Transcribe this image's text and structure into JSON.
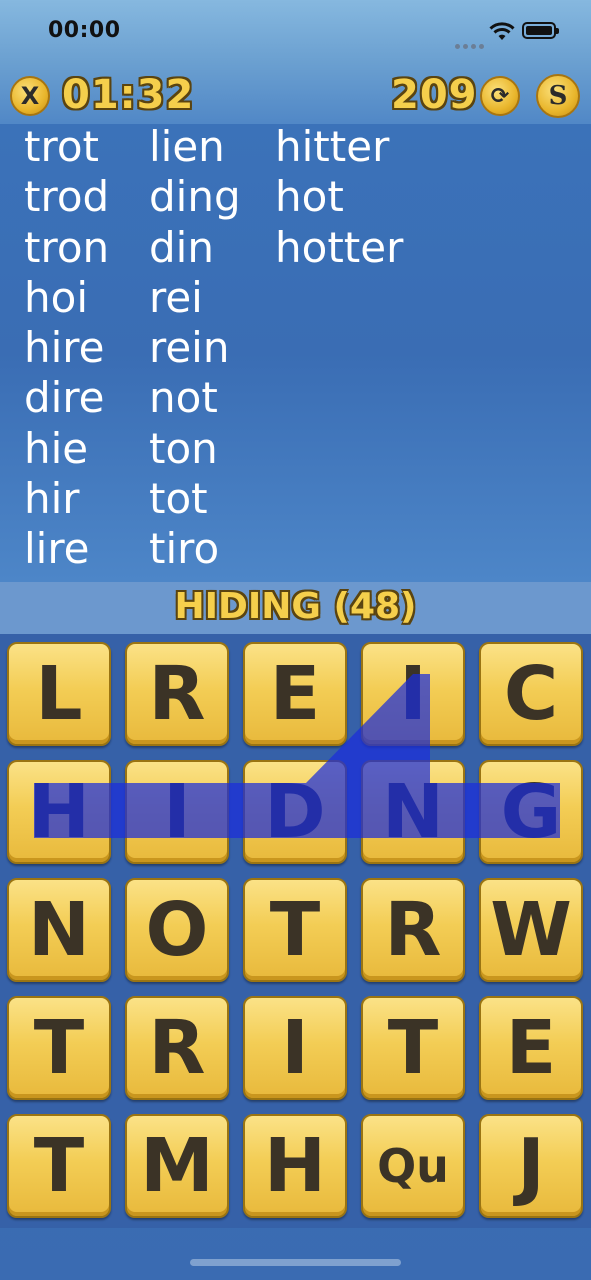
{
  "status_bar": {
    "time": "00:00"
  },
  "hud": {
    "close_icon_label": "X",
    "timer": "01:32",
    "score": "209",
    "refresh_icon_label": "⟳",
    "coins_icon_label": "S"
  },
  "found_words": {
    "column1": [
      "trot",
      "trod",
      "tron",
      "hoi",
      "hire",
      "dire",
      "hie",
      "hir",
      "lire"
    ],
    "column2": [
      "lien",
      "ding",
      "din",
      "rei",
      "rein",
      "not",
      "ton",
      "tot",
      "tiro"
    ],
    "column3": [
      "hitter",
      "hot",
      "hotter"
    ]
  },
  "current_word": "HIDING (48)",
  "board": {
    "rows": [
      [
        "L",
        "R",
        "E",
        "I",
        "C"
      ],
      [
        "H",
        "I",
        "D",
        "N",
        "G"
      ],
      [
        "N",
        "O",
        "T",
        "R",
        "W"
      ],
      [
        "T",
        "R",
        "I",
        "T",
        "E"
      ],
      [
        "T",
        "M",
        "H",
        "Qu",
        "J"
      ]
    ],
    "selected_path": [
      "H",
      "I",
      "D",
      "I",
      "N",
      "G"
    ],
    "path_color": "#1a2ddb"
  },
  "colors": {
    "accent": "#f5cf4c",
    "background": "#3a6bb2",
    "tile": "#f3cd55"
  }
}
